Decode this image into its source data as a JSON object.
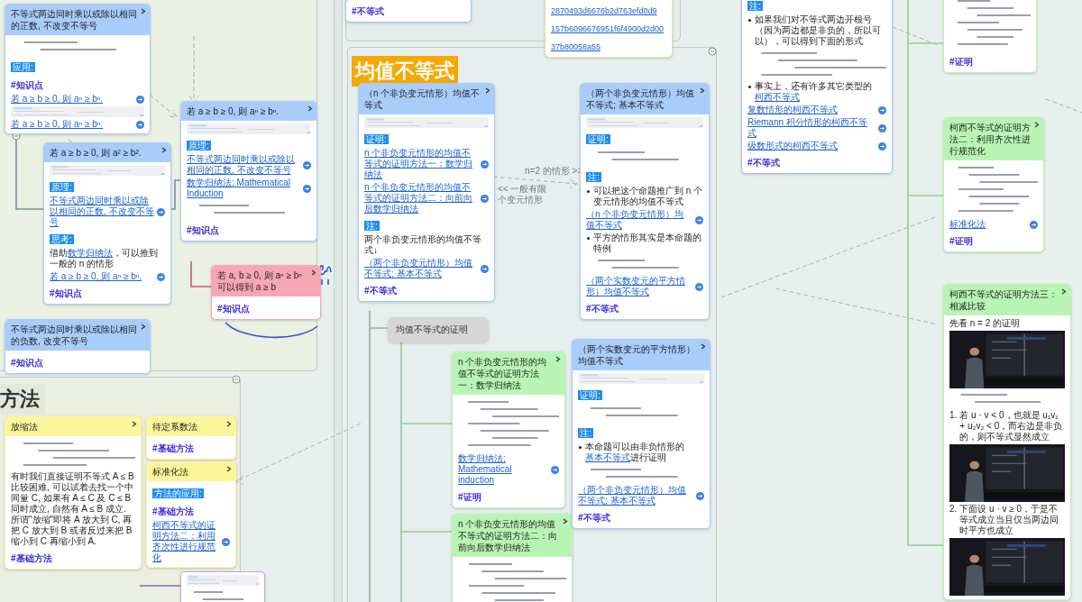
{
  "sections": [
    {
      "title": "均值不等式",
      "kind": "highlight"
    },
    {
      "title": "方法",
      "kind": "plain"
    }
  ],
  "edge_labels": [
    "<< 一般有限个变元情形",
    "n=2 的情形 >>"
  ],
  "cards": [
    {
      "kind": "card",
      "color": "#a9cdfb",
      "title": "不等式两边同时乘以或除以相同的正数, 不改变不等号",
      "blocks": [
        {
          "kind": "formula"
        },
        {
          "kind": "label",
          "text": "应用:"
        },
        {
          "kind": "tag",
          "text": "#知识点"
        },
        {
          "kind": "link",
          "text": "若 a ≥ b ≥ 0, 则 aⁿ ≥ bⁿ."
        },
        {
          "kind": "preview"
        },
        {
          "kind": "link",
          "text": "若 a ≥ b ≥ 0, 则 aⁿ ≥ bⁿ."
        }
      ]
    },
    {
      "kind": "card",
      "color": "#a9cdfb",
      "title": "若 a ≥ b ≥ 0, 则 a² ≥ b².",
      "blocks": [
        {
          "kind": "preview"
        },
        {
          "kind": "label",
          "text": "原理:"
        },
        {
          "kind": "link",
          "text": "不等式两边同时乘以或除以相同的正数, 不改变不等号"
        },
        {
          "kind": "label",
          "text": "思考:"
        },
        {
          "kind": "text",
          "parts": [
            {
              "text": "借助",
              "link": false
            },
            {
              "text": "数学归纳法",
              "link": true
            },
            {
              "text": "，可以推到一般的 n 的情形",
              "link": false
            }
          ]
        },
        {
          "kind": "link",
          "text": "若 a ≥ b ≥ 0, 则 aⁿ ≥ bⁿ."
        },
        {
          "kind": "tag",
          "text": "#知识点"
        }
      ]
    },
    {
      "kind": "card",
      "color": "#a9cdfb",
      "title": "若 a ≥ b ≥ 0, 则 aⁿ ≥ bⁿ.",
      "blocks": [
        {
          "kind": "preview"
        },
        {
          "kind": "label",
          "text": "原理:"
        },
        {
          "kind": "link",
          "text": "不等式两边同时乘以或除以相同的正数, 不改变不等号"
        },
        {
          "kind": "link",
          "text": "数学归纳法; Mathematical Induction"
        },
        {
          "kind": "formula"
        },
        {
          "kind": "tag",
          "text": "#知识点"
        }
      ]
    },
    {
      "kind": "card",
      "color": "#f7a7b3",
      "title": "若 a, b ≥ 0, 则 aⁿ ≥ bⁿ 可以得到 a ≥ b",
      "blocks": [
        {
          "kind": "tag",
          "text": "#知识点"
        }
      ]
    },
    {
      "kind": "card",
      "color": "#a9cdfb",
      "title": "不等式两边同时乘以或除以相同的负数, 改变不等号",
      "blocks": [
        {
          "kind": "tag",
          "text": "#知识点"
        }
      ]
    },
    {
      "kind": "card",
      "color": "#fdf59a",
      "title": "放缩法",
      "blocks": [
        {
          "kind": "formulablock"
        },
        {
          "kind": "text",
          "parts": [
            {
              "text": "有时我们直接证明不等式 A ≤ B 比较困难, 可以试着去找一个中间量 C, 如果有 A ≤ C 及 C ≤ B 同时成立, 自然有 A ≤ B 成立. 所谓\"放缩\"即将 A 放大到 C, 再把 C 放大到 B 或者反过来把 B 缩小到 C 再缩小到 A.",
              "link": false
            }
          ]
        },
        {
          "kind": "tag",
          "text": "#基础方法"
        }
      ]
    },
    {
      "kind": "card",
      "color": "#fdf59a",
      "title": "待定系数法",
      "blocks": [
        {
          "kind": "tag",
          "text": "#基础方法"
        }
      ]
    },
    {
      "kind": "card",
      "color": "#fdf59a",
      "title": "标准化法",
      "blocks": [
        {
          "kind": "label",
          "text": "方法的应用:"
        },
        {
          "kind": "tag",
          "text": "#基础方法"
        },
        {
          "kind": "link",
          "text": "柯西不等式的证明方法二：利用齐次性进行规范化"
        }
      ]
    },
    {
      "kind": "card",
      "color": "#c9a4e6",
      "blocks": [
        {
          "kind": "preview"
        },
        {
          "kind": "formulablock"
        }
      ]
    },
    {
      "kind": "card",
      "color": "#a9c4e8",
      "blocks": [
        {
          "kind": "tag",
          "text": "#不等式"
        }
      ]
    },
    {
      "kind": "card",
      "color": "#e6e0a0",
      "blocks": [
        {
          "kind": "plainlink",
          "text": "2870493d6676b2d763efd0d9"
        },
        {
          "kind": "plainlink",
          "text": "157b6096676951f6f4900d2d00"
        },
        {
          "kind": "plainlink",
          "text": "37b80058a55"
        }
      ]
    },
    {
      "kind": "card",
      "color": "#a9cdfb",
      "title": "（n 个非负变元情形）均值不等式",
      "blocks": [
        {
          "kind": "preview"
        },
        {
          "kind": "label",
          "text": "证明:"
        },
        {
          "kind": "link",
          "text": "n 个非负变元情形的均值不等式的证明方法一：数学归纳法"
        },
        {
          "kind": "link",
          "text": "n 个非负变元情形的均值不等式的证明方法二：向前向后数学归纳法"
        },
        {
          "kind": "label",
          "text": "注:"
        },
        {
          "kind": "text",
          "parts": [
            {
              "text": "两个非负变元情形的均值不等式↓",
              "link": false
            }
          ]
        },
        {
          "kind": "link",
          "text": "（两个非负变元情形）均值不等式; 基本不等式"
        },
        {
          "kind": "tag",
          "text": "#不等式"
        }
      ]
    },
    {
      "kind": "topic",
      "color": "#d6d6d6",
      "title": "均值不等式的证明"
    },
    {
      "kind": "card",
      "color": "#b8f5b4",
      "title": "n 个非负变元情形的均值不等式的证明方法一：数学归纳法",
      "blocks": [
        {
          "kind": "derivation"
        },
        {
          "kind": "link",
          "text": "数学归纳法; Mathematical induction"
        },
        {
          "kind": "tag",
          "text": "#证明"
        }
      ]
    },
    {
      "kind": "card",
      "color": "#b8f5b4",
      "title": "n 个非负变元情形的均值不等式的证明方法二：向前向后数学归纳法",
      "blocks": [
        {
          "kind": "derivation"
        }
      ]
    },
    {
      "kind": "card",
      "color": "#a9cdfb",
      "title": "（两个非负变元情形）均值不等式; 基本不等式",
      "blocks": [
        {
          "kind": "preview"
        },
        {
          "kind": "label",
          "text": "证明:"
        },
        {
          "kind": "formula"
        },
        {
          "kind": "label",
          "text": "注:"
        },
        {
          "kind": "bullet",
          "parts": [
            {
              "text": "可以把这个命题推广到 n 个变元情形的均值不等式",
              "link": false
            }
          ]
        },
        {
          "kind": "link",
          "text": "（n 个非负变元情形）均值不等式"
        },
        {
          "kind": "bullet",
          "parts": [
            {
              "text": "平方的情形其实是本命题的特例",
              "link": false
            }
          ]
        },
        {
          "kind": "formula"
        },
        {
          "kind": "link",
          "text": "（两个实数变元的平方情形）均值不等式"
        },
        {
          "kind": "tag",
          "text": "#不等式"
        }
      ]
    },
    {
      "kind": "card",
      "color": "#a9cdfb",
      "title": "（两个实数变元的平方情形）均值不等式",
      "blocks": [
        {
          "kind": "preview"
        },
        {
          "kind": "label",
          "text": "证明:"
        },
        {
          "kind": "formula"
        },
        {
          "kind": "label",
          "text": "注:"
        },
        {
          "kind": "bullet",
          "parts": [
            {
              "text": "本命题可以由非负情形的",
              "link": false
            },
            {
              "text": "基本不等式",
              "link": true
            },
            {
              "text": "进行证明",
              "link": false
            }
          ]
        },
        {
          "kind": "formula"
        },
        {
          "kind": "link",
          "text": "（两个非负变元情形）均值不等式; 基本不等式"
        },
        {
          "kind": "tag",
          "text": "#不等式"
        }
      ]
    },
    {
      "kind": "card",
      "color": "#a9c4e8",
      "blocks": [
        {
          "kind": "label",
          "text": "注:"
        },
        {
          "kind": "bullet",
          "parts": [
            {
              "text": "如果我们对不等式两边开根号（因为两边都是非负的，所以可以），可以得到下面的形式",
              "link": false
            }
          ]
        },
        {
          "kind": "formulablock"
        },
        {
          "kind": "bullet",
          "parts": [
            {
              "text": "事实上，还有许多其它类型的",
              "link": false
            },
            {
              "text": "柯西不等式",
              "link": true
            }
          ]
        },
        {
          "kind": "link",
          "text": "复数情形的柯西不等式"
        },
        {
          "kind": "link",
          "text": "Riemann 积分情形的柯西不等式"
        },
        {
          "kind": "link",
          "text": "级数形式的柯西不等式"
        },
        {
          "kind": "tag",
          "text": "#不等式"
        }
      ]
    },
    {
      "kind": "card",
      "color": "#b8f5b4",
      "blocks": [
        {
          "kind": "derivation"
        },
        {
          "kind": "tag",
          "text": "#证明"
        }
      ]
    },
    {
      "kind": "card",
      "color": "#b8f5b4",
      "title": "柯西不等式的证明方法二：利用齐次性进行规范化",
      "blocks": [
        {
          "kind": "derivation"
        },
        {
          "kind": "link",
          "text": "标准化法"
        },
        {
          "kind": "tag",
          "text": "#证明"
        }
      ]
    },
    {
      "kind": "card",
      "color": "#b8f5b4",
      "title": "柯西不等式的证明方法三：相减比较",
      "blocks": [
        {
          "kind": "text",
          "parts": [
            {
              "text": "先看 n = 2 的证明",
              "link": false
            }
          ]
        },
        {
          "kind": "picture"
        },
        {
          "kind": "formula"
        },
        {
          "kind": "numbered",
          "number": "1.",
          "text": "若 u · v < 0，也就是 u₁v₁ + u₂v₂ < 0，而右边是非负的，则不等式显然成立"
        },
        {
          "kind": "picture"
        },
        {
          "kind": "numbered",
          "number": "2.",
          "text": "下面设 u · v ≥ 0，于是不等式成立当且仅当两边同时平方也成立"
        },
        {
          "kind": "picture"
        }
      ]
    }
  ]
}
